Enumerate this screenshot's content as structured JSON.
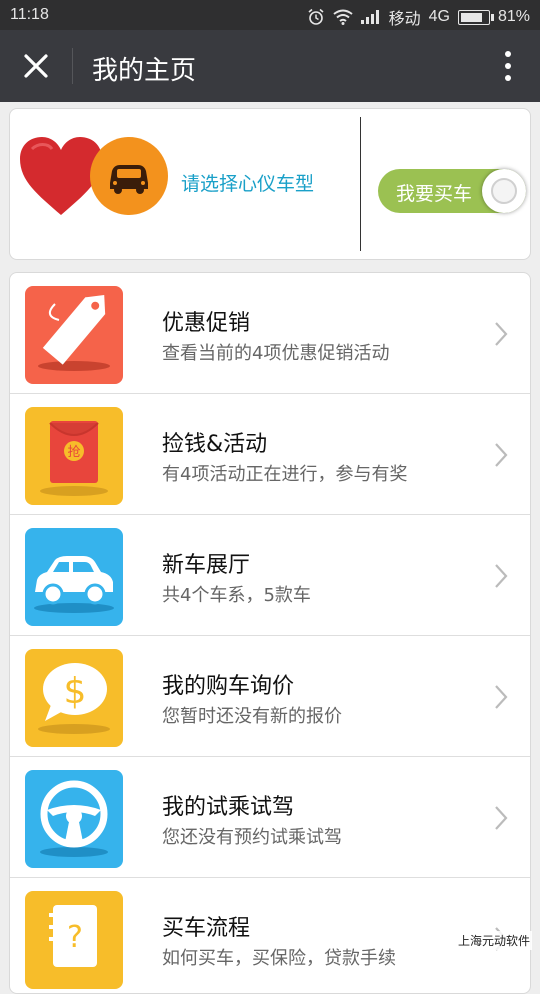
{
  "status": {
    "time": "11:18",
    "carrier": "移动",
    "network": "4G",
    "battery": "81%",
    "battery_level": 0.81
  },
  "nav": {
    "title": "我的主页"
  },
  "top": {
    "choose_text": "请选择心仪车型",
    "toggle_label": "我要买车",
    "toggle_on": true
  },
  "list": [
    {
      "title": "优惠促销",
      "sub": "查看当前的4项优惠促销活动",
      "icon": "price-tag-icon",
      "color": "#f5634a"
    },
    {
      "title": "捡钱&活动",
      "sub": "有4项活动正在进行，参与有奖",
      "icon": "red-envelope-icon",
      "color": "#f7bd2a",
      "icon_text": "抢"
    },
    {
      "title": "新车展厅",
      "sub": "共4个车系，5款车",
      "icon": "car-icon",
      "color": "#36b3ec"
    },
    {
      "title": "我的购车询价",
      "sub": "您暂时还没有新的报价",
      "icon": "price-bubble-icon",
      "color": "#f7bd2a",
      "icon_text": "$"
    },
    {
      "title": "我的试乘试驾",
      "sub": "您还没有预约试乘试驾",
      "icon": "steering-wheel-icon",
      "color": "#36b3ec"
    },
    {
      "title": "买车流程",
      "sub": "如何买车，买保险，贷款手续",
      "icon": "help-book-icon",
      "color": "#f7bd2a",
      "icon_text": "?"
    }
  ],
  "watermark": "上海元动软件",
  "colors": {
    "navbar": "#393a3f",
    "statusbar": "#2f2f30",
    "accent_text": "#1aa0c8",
    "toggle": "#9bc152"
  }
}
